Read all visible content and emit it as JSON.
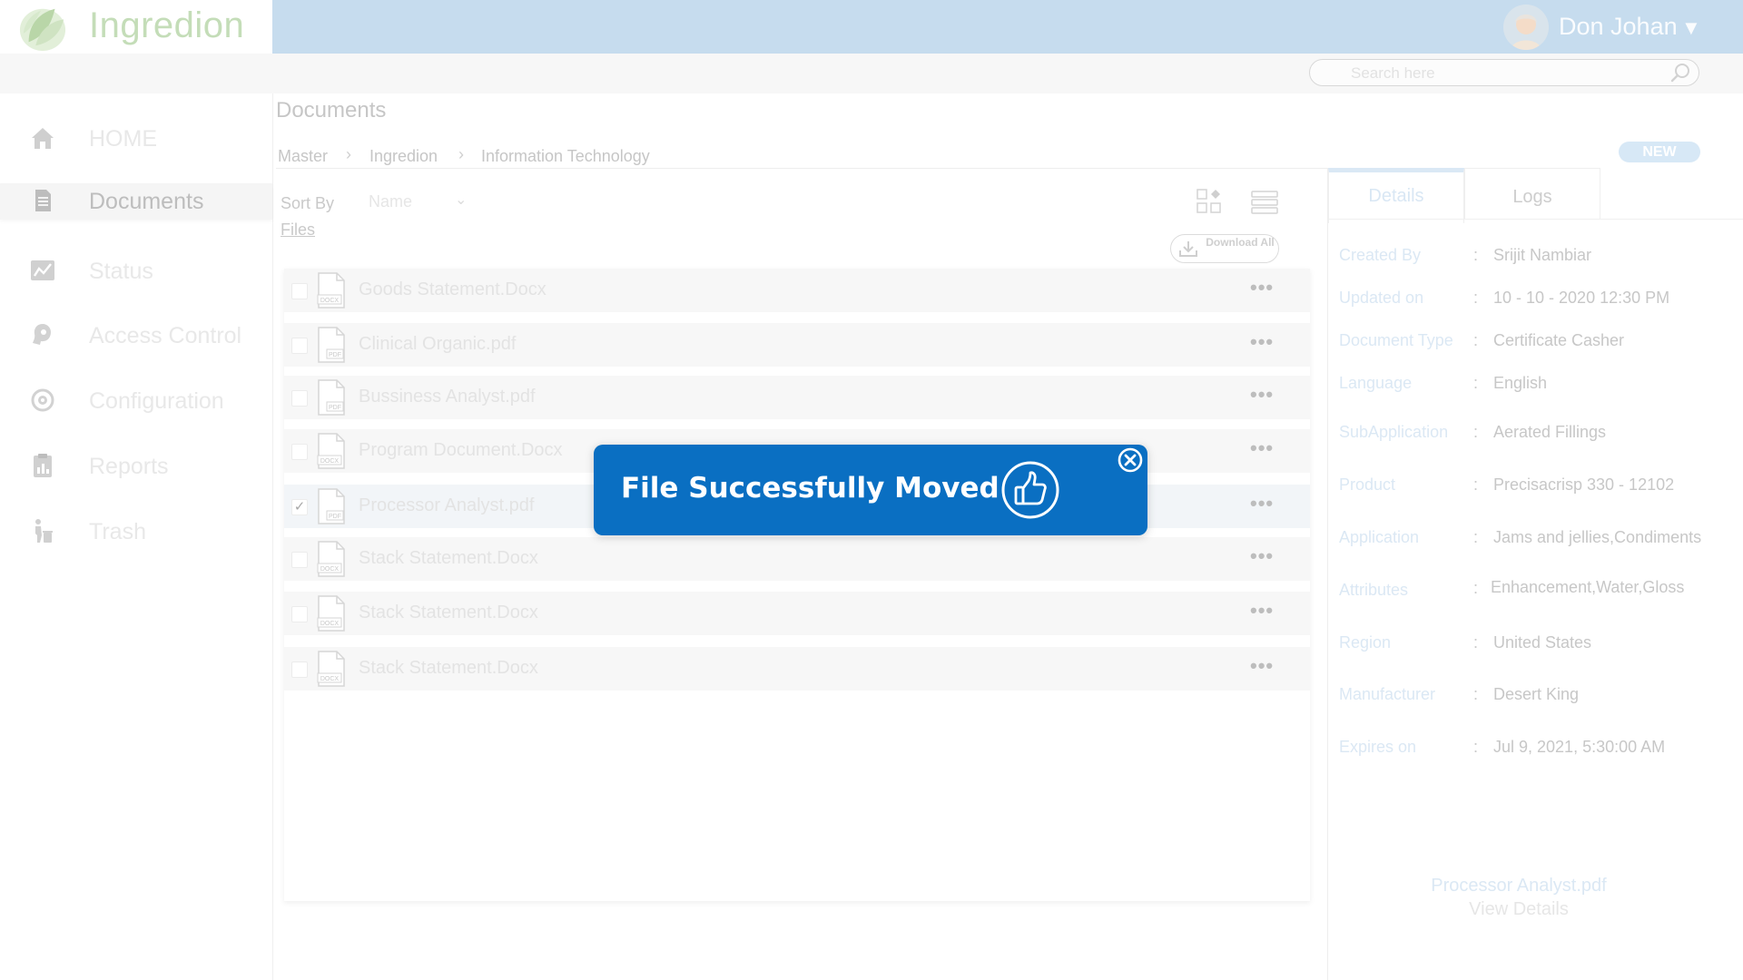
{
  "header": {
    "brand": "Ingredion",
    "user_name": "Don Johan",
    "caret": "▼"
  },
  "search": {
    "placeholder": "Search here"
  },
  "sidebar": {
    "items": [
      {
        "label": "HOME",
        "icon": "home-icon"
      },
      {
        "label": "Documents",
        "icon": "document-icon",
        "active": true
      },
      {
        "label": "Status",
        "icon": "status-chart-icon"
      },
      {
        "label": "Access Control",
        "icon": "access-control-icon"
      },
      {
        "label": "Configuration",
        "icon": "configuration-gear-icon"
      },
      {
        "label": "Reports",
        "icon": "reports-clipboard-icon"
      },
      {
        "label": "Trash",
        "icon": "trash-person-icon"
      }
    ]
  },
  "main": {
    "title": "Documents",
    "breadcrumb": [
      "Master",
      "Ingredion",
      "Information Technology"
    ],
    "breadcrumb_sep": "›",
    "new_label": "NEW",
    "sort_by_label": "Sort By",
    "sort_value": "Name",
    "sort_caret": "⌄",
    "files_label": "Files",
    "download_all": "Download All",
    "more_glyph": "•••",
    "files": [
      {
        "name": "Goods Statement.Docx",
        "type": "DOCX",
        "checked": false
      },
      {
        "name": "Clinical Organic.pdf",
        "type": "PDF",
        "checked": false
      },
      {
        "name": "Bussiness Analyst.pdf",
        "type": "PDF",
        "checked": false
      },
      {
        "name": "Program Document.Docx",
        "type": "DOCX",
        "checked": false
      },
      {
        "name": "Processor Analyst.pdf",
        "type": "PDF",
        "checked": true
      },
      {
        "name": "Stack Statement.Docx",
        "type": "DOCX",
        "checked": false
      },
      {
        "name": "Stack Statement.Docx",
        "type": "DOCX",
        "checked": false
      },
      {
        "name": "Stack Statement.Docx",
        "type": "DOCX",
        "checked": false
      }
    ]
  },
  "details": {
    "tabs": [
      "Details",
      "Logs"
    ],
    "active_tab": "Details",
    "colon": ":",
    "fields": [
      {
        "key": "Created By",
        "value": "Srijit Nambiar"
      },
      {
        "key": "Updated on",
        "value": "10 - 10 - 2020  12:30 PM"
      },
      {
        "key": "Document Type",
        "value": "Certificate Casher"
      },
      {
        "key": "Language",
        "value": "English"
      },
      {
        "key": "SubApplication",
        "value": "Aerated Fillings"
      },
      {
        "key": "Product",
        "value": "Precisacrisp 330 - 12102"
      },
      {
        "key": "Application",
        "value": "Jams and jellies,Condiments"
      },
      {
        "key": "Attributes",
        "value": "Enhancement,Water,Gloss"
      },
      {
        "key": "Region",
        "value": "United States"
      },
      {
        "key": "Manufacturer",
        "value": "Desert King"
      },
      {
        "key": "Expires on",
        "value": "Jul 9, 2021, 5:30:00 AM"
      }
    ],
    "preview_file": "Processor Analyst.pdf",
    "view_details": "View Details"
  },
  "toast": {
    "message": "File Successfully Moved",
    "icon": "thumbs-up-icon",
    "close_icon": "close-circle-icon"
  },
  "colors": {
    "topbar": "#c6dcee",
    "toast": "#0a6fc2",
    "brand_green": "#c4ddb8"
  }
}
